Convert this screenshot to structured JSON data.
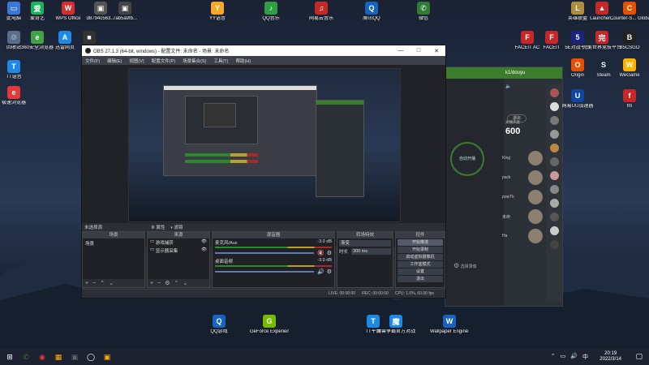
{
  "desktop": {
    "icons_left": [
      {
        "label": "此电脑",
        "color": "#3a78d8",
        "glyph": "▭"
      },
      {
        "label": "回收站",
        "color": "#5b6d8a",
        "glyph": "♲"
      },
      {
        "label": "TT语音",
        "color": "#1e88e5",
        "glyph": "T"
      },
      {
        "label": "极速浏览器",
        "color": "#e53935",
        "glyph": "e"
      }
    ],
    "icons_top": [
      {
        "label": "爱奇艺",
        "color": "#18b35a",
        "glyph": "爱"
      },
      {
        "label": "WPS Office",
        "color": "#d32f2f",
        "glyph": "W"
      },
      {
        "label": "d8794c563...",
        "color": "#555",
        "glyph": "▣"
      },
      {
        "label": "7ab5a9fb...",
        "color": "#444",
        "glyph": "▣"
      },
      {
        "label": "YY语音",
        "color": "#f9a825",
        "glyph": "Y"
      },
      {
        "label": "QQ音乐",
        "color": "#2ea043",
        "glyph": "♪"
      },
      {
        "label": "网易云音乐",
        "color": "#c62828",
        "glyph": "♫"
      },
      {
        "label": "腾讯QQ",
        "color": "#1565c0",
        "glyph": "Q"
      },
      {
        "label": "微信",
        "color": "#2e7d32",
        "glyph": "✆"
      }
    ],
    "icons_row2": [
      {
        "label": "360安全浏览器",
        "color": "#43a047",
        "glyph": "e"
      },
      {
        "label": "迅雷网页",
        "color": "#1e88e5",
        "glyph": "A"
      },
      {
        "label": "",
        "color": "#333",
        "glyph": "■"
      }
    ],
    "icons_right": [
      {
        "label": "英雄联盟",
        "color": "#b08d3a",
        "glyph": "L"
      },
      {
        "label": "Launcher...",
        "color": "#c62828",
        "glyph": "▲"
      },
      {
        "label": "Counter-S... Global Off...",
        "color": "#e65100",
        "glyph": "C"
      },
      {
        "label": "FACEIT AC",
        "color": "#c62828",
        "glyph": "F"
      },
      {
        "label": "FACEIT",
        "color": "#c62828",
        "glyph": "F"
      },
      {
        "label": "5E对战平台",
        "color": "#1a237e",
        "glyph": "5"
      },
      {
        "label": "完美世界竞技平台",
        "color": "#c62828",
        "glyph": "完"
      },
      {
        "label": "B5CSGO",
        "color": "#222",
        "glyph": "B"
      },
      {
        "label": "Origin",
        "color": "#e65100",
        "glyph": "O"
      },
      {
        "label": "Steam",
        "color": "#1b2838",
        "glyph": "S"
      },
      {
        "label": "WeGame",
        "color": "#ffb300",
        "glyph": "W"
      },
      {
        "label": "网易UU加速器",
        "color": "#0d47a1",
        "glyph": "U"
      },
      {
        "label": "fm",
        "color": "#c62828",
        "glyph": "f"
      }
    ],
    "icons_bottom": [
      {
        "label": "QQ游戏",
        "color": "#1565c0",
        "glyph": "Q"
      },
      {
        "label": "GeForce Experience",
        "color": "#76b900",
        "glyph": "G"
      },
      {
        "label": "TT平台",
        "color": "#1e88e5",
        "glyph": "T"
      },
      {
        "label": "魔兽争霸官方对战平台",
        "color": "#1e88e5",
        "glyph": "魔"
      },
      {
        "label": "Wallpaper Engine: ...",
        "color": "#1565c0",
        "glyph": "W"
      }
    ]
  },
  "obs": {
    "title": "OBS 27.1.3 (64-bit, windows) - 配置文件: 未命名 - 场景: 未命名",
    "menu": [
      "文件(F)",
      "编辑(E)",
      "视图(V)",
      "配置文件(P)",
      "场景集合(S)",
      "工具(T)",
      "帮助(H)"
    ],
    "scene_bar": {
      "label": "未选择源",
      "props": "属性",
      "filters": "滤镜"
    },
    "docks": {
      "scenes": {
        "header": "场景",
        "items": [
          "场景"
        ]
      },
      "sources": {
        "header": "来源",
        "items": [
          "游戏捕获",
          "显示器采集"
        ]
      },
      "mixer": {
        "header": "混音器",
        "tracks": [
          {
            "name": "麦克风/Aux",
            "db": "-3.0 dB"
          },
          {
            "name": "桌面音频",
            "db": "-3.0 dB"
          }
        ]
      },
      "transitions": {
        "header": "转场特效",
        "type": "渐变",
        "duration_label": "时长",
        "duration": "300 ms"
      },
      "controls": {
        "header": "控件",
        "buttons": [
          "开始推流",
          "开始录制",
          "启动虚拟摄像机",
          "工作室模式",
          "设置",
          "退出"
        ]
      }
    },
    "status": {
      "live": "LIVE: 00:00:00",
      "rec": "REC: 00:00:00",
      "cpu": "CPU: 1.0%, 60.00 fps"
    }
  },
  "douyu": {
    "user": "k1/douyu",
    "exit_label": "退出",
    "counter": "600",
    "counter_label": "关播热度",
    "center_label": "自动开播",
    "sub_label": "自动开播",
    "sidebar_labels": [
      "Klng",
      "pack",
      "powTk",
      "未命",
      "Ha"
    ],
    "bottom_label": "选择录像"
  },
  "taskbar": {
    "items": [
      {
        "glyph": "⊞",
        "color": "#ffffff"
      },
      {
        "glyph": "✆",
        "color": "#2e7d32"
      },
      {
        "glyph": "◉",
        "color": "#e53935"
      },
      {
        "glyph": "▦",
        "color": "#ffb300"
      },
      {
        "glyph": "▣",
        "color": "#666"
      },
      {
        "glyph": "◯",
        "color": "#fff"
      },
      {
        "glyph": "▣",
        "color": "#ffb300"
      }
    ],
    "time": "20:19",
    "date": "2022/3/14"
  }
}
